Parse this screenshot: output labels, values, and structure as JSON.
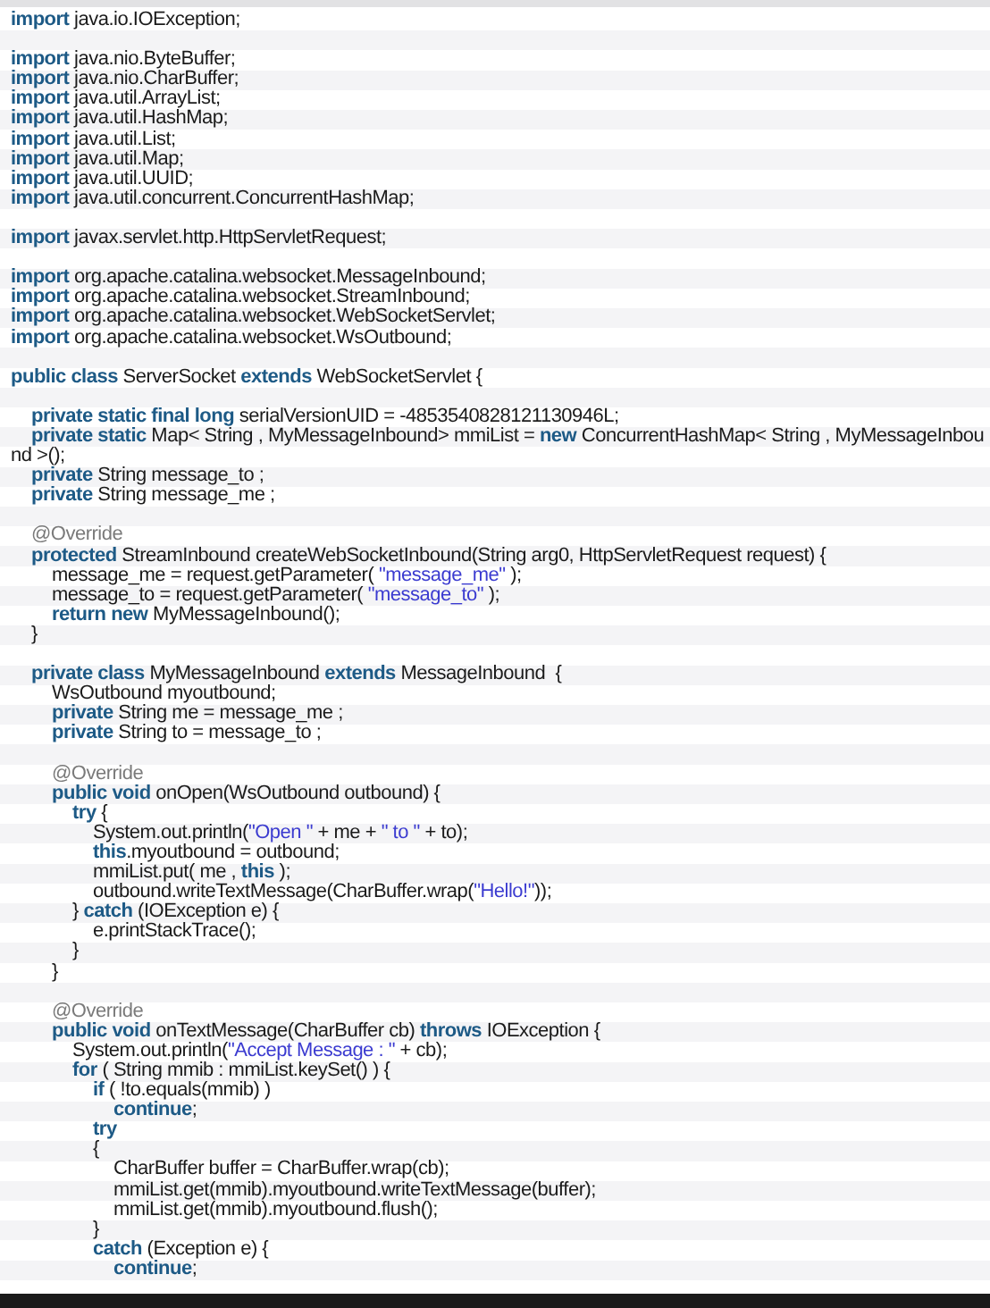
{
  "editor": {
    "lines": [
      {
        "kind": "code",
        "segments": [
          {
            "kind": "keyword",
            "text": "import"
          },
          {
            "kind": "plain",
            "text": " java.io.IOException;"
          }
        ]
      },
      {
        "kind": "blank"
      },
      {
        "kind": "code",
        "segments": [
          {
            "kind": "keyword",
            "text": "import"
          },
          {
            "kind": "plain",
            "text": " java.nio.ByteBuffer;"
          }
        ]
      },
      {
        "kind": "code",
        "segments": [
          {
            "kind": "keyword",
            "text": "import"
          },
          {
            "kind": "plain",
            "text": " java.nio.CharBuffer;"
          }
        ]
      },
      {
        "kind": "code",
        "segments": [
          {
            "kind": "keyword",
            "text": "import"
          },
          {
            "kind": "plain",
            "text": " java.util.ArrayList;"
          }
        ]
      },
      {
        "kind": "code",
        "segments": [
          {
            "kind": "keyword",
            "text": "import"
          },
          {
            "kind": "plain",
            "text": " java.util.HashMap;"
          }
        ]
      },
      {
        "kind": "code",
        "segments": [
          {
            "kind": "keyword",
            "text": "import"
          },
          {
            "kind": "plain",
            "text": " java.util.List;"
          }
        ]
      },
      {
        "kind": "code",
        "segments": [
          {
            "kind": "keyword",
            "text": "import"
          },
          {
            "kind": "plain",
            "text": " java.util.Map;"
          }
        ]
      },
      {
        "kind": "code",
        "segments": [
          {
            "kind": "keyword",
            "text": "import"
          },
          {
            "kind": "plain",
            "text": " java.util.UUID;"
          }
        ]
      },
      {
        "kind": "code",
        "segments": [
          {
            "kind": "keyword",
            "text": "import"
          },
          {
            "kind": "plain",
            "text": " java.util.concurrent.ConcurrentHashMap;"
          }
        ]
      },
      {
        "kind": "blank"
      },
      {
        "kind": "code",
        "segments": [
          {
            "kind": "keyword",
            "text": "import"
          },
          {
            "kind": "plain",
            "text": " javax.servlet.http.HttpServletRequest;"
          }
        ]
      },
      {
        "kind": "blank"
      },
      {
        "kind": "code",
        "segments": [
          {
            "kind": "keyword",
            "text": "import"
          },
          {
            "kind": "plain",
            "text": " org.apache.catalina.websocket.MessageInbound;"
          }
        ]
      },
      {
        "kind": "code",
        "segments": [
          {
            "kind": "keyword",
            "text": "import"
          },
          {
            "kind": "plain",
            "text": " org.apache.catalina.websocket.StreamInbound;"
          }
        ]
      },
      {
        "kind": "code",
        "segments": [
          {
            "kind": "keyword",
            "text": "import"
          },
          {
            "kind": "plain",
            "text": " org.apache.catalina.websocket.WebSocketServlet;"
          }
        ]
      },
      {
        "kind": "code",
        "segments": [
          {
            "kind": "keyword",
            "text": "import"
          },
          {
            "kind": "plain",
            "text": " org.apache.catalina.websocket.WsOutbound;"
          }
        ]
      },
      {
        "kind": "blank"
      },
      {
        "kind": "code",
        "segments": [
          {
            "kind": "keyword",
            "text": "public class"
          },
          {
            "kind": "plain",
            "text": " ServerSocket "
          },
          {
            "kind": "keyword",
            "text": "extends"
          },
          {
            "kind": "plain",
            "text": " WebSocketServlet {"
          }
        ]
      },
      {
        "kind": "blank"
      },
      {
        "kind": "code",
        "segments": [
          {
            "kind": "keyword",
            "text": "\tprivate static final long"
          },
          {
            "kind": "plain",
            "text": " serialVersionUID = -4853540828121130946L;"
          }
        ]
      },
      {
        "kind": "code",
        "segments": [
          {
            "kind": "keyword",
            "text": "\tprivate static"
          },
          {
            "kind": "plain",
            "text": " Map< String , MyMessageInbound> mmiList = "
          },
          {
            "kind": "keyword",
            "text": "new"
          },
          {
            "kind": "plain",
            "text": " ConcurrentHashMap< String , MyMessageInbou"
          }
        ]
      },
      {
        "kind": "code",
        "segments": [
          {
            "kind": "plain",
            "text": "nd >();"
          }
        ]
      },
      {
        "kind": "code",
        "segments": [
          {
            "kind": "keyword",
            "text": "\tprivate"
          },
          {
            "kind": "plain",
            "text": " String message_to ;"
          }
        ]
      },
      {
        "kind": "code",
        "segments": [
          {
            "kind": "keyword",
            "text": "\tprivate"
          },
          {
            "kind": "plain",
            "text": " String message_me ;"
          }
        ]
      },
      {
        "kind": "blank"
      },
      {
        "kind": "code",
        "segments": [
          {
            "kind": "annotation",
            "text": "\t@Override"
          }
        ]
      },
      {
        "kind": "code",
        "segments": [
          {
            "kind": "keyword",
            "text": "\tprotected"
          },
          {
            "kind": "plain",
            "text": " StreamInbound createWebSocketInbound(String arg0, HttpServletRequest request) {"
          }
        ]
      },
      {
        "kind": "code",
        "segments": [
          {
            "kind": "plain",
            "text": "\t\tmessage_me = request.getParameter( "
          },
          {
            "kind": "string",
            "text": "\"message_me\""
          },
          {
            "kind": "plain",
            "text": " );"
          }
        ]
      },
      {
        "kind": "code",
        "segments": [
          {
            "kind": "plain",
            "text": "\t\tmessage_to = request.getParameter( "
          },
          {
            "kind": "string",
            "text": "\"message_to\""
          },
          {
            "kind": "plain",
            "text": " );"
          }
        ]
      },
      {
        "kind": "code",
        "segments": [
          {
            "kind": "keyword",
            "text": "\t\treturn new"
          },
          {
            "kind": "plain",
            "text": " MyMessageInbound();"
          }
        ]
      },
      {
        "kind": "code",
        "segments": [
          {
            "kind": "plain",
            "text": "\t}"
          }
        ]
      },
      {
        "kind": "blank"
      },
      {
        "kind": "code",
        "segments": [
          {
            "kind": "keyword",
            "text": "\tprivate class"
          },
          {
            "kind": "plain",
            "text": " MyMessageInbound "
          },
          {
            "kind": "keyword",
            "text": "extends"
          },
          {
            "kind": "plain",
            "text": " MessageInbound  {"
          }
        ]
      },
      {
        "kind": "code",
        "segments": [
          {
            "kind": "plain",
            "text": "\t\tWsOutbound myoutbound;"
          }
        ]
      },
      {
        "kind": "code",
        "segments": [
          {
            "kind": "keyword",
            "text": "\t\tprivate"
          },
          {
            "kind": "plain",
            "text": " String me = message_me ;"
          }
        ]
      },
      {
        "kind": "code",
        "segments": [
          {
            "kind": "keyword",
            "text": "\t\tprivate"
          },
          {
            "kind": "plain",
            "text": " String to = message_to ;"
          }
        ]
      },
      {
        "kind": "blank"
      },
      {
        "kind": "code",
        "segments": [
          {
            "kind": "annotation",
            "text": "\t\t@Override"
          }
        ]
      },
      {
        "kind": "code",
        "segments": [
          {
            "kind": "keyword",
            "text": "\t\tpublic void"
          },
          {
            "kind": "plain",
            "text": " onOpen(WsOutbound outbound) {"
          }
        ]
      },
      {
        "kind": "code",
        "segments": [
          {
            "kind": "keyword",
            "text": "\t\t\ttry"
          },
          {
            "kind": "plain",
            "text": " {"
          }
        ]
      },
      {
        "kind": "code",
        "segments": [
          {
            "kind": "plain",
            "text": "\t\t\t\tSystem.out.println("
          },
          {
            "kind": "string",
            "text": "\"Open \""
          },
          {
            "kind": "plain",
            "text": " + me + "
          },
          {
            "kind": "string",
            "text": "\" to \""
          },
          {
            "kind": "plain",
            "text": " + to);"
          }
        ]
      },
      {
        "kind": "code",
        "segments": [
          {
            "kind": "keyword",
            "text": "\t\t\t\tthis"
          },
          {
            "kind": "plain",
            "text": ".myoutbound = outbound;"
          }
        ]
      },
      {
        "kind": "code",
        "segments": [
          {
            "kind": "plain",
            "text": "\t\t\t\tmmiList.put( me , "
          },
          {
            "kind": "keyword",
            "text": "this"
          },
          {
            "kind": "plain",
            "text": " );"
          }
        ]
      },
      {
        "kind": "code",
        "segments": [
          {
            "kind": "plain",
            "text": "\t\t\t\toutbound.writeTextMessage(CharBuffer.wrap("
          },
          {
            "kind": "string",
            "text": "\"Hello!\""
          },
          {
            "kind": "plain",
            "text": "));"
          }
        ]
      },
      {
        "kind": "code",
        "segments": [
          {
            "kind": "plain",
            "text": "\t\t\t} "
          },
          {
            "kind": "keyword",
            "text": "catch"
          },
          {
            "kind": "plain",
            "text": " (IOException e) {"
          }
        ]
      },
      {
        "kind": "code",
        "segments": [
          {
            "kind": "plain",
            "text": "\t\t\t\te.printStackTrace();"
          }
        ]
      },
      {
        "kind": "code",
        "segments": [
          {
            "kind": "plain",
            "text": "\t\t\t}"
          }
        ]
      },
      {
        "kind": "code",
        "segments": [
          {
            "kind": "plain",
            "text": "\t\t}"
          }
        ]
      },
      {
        "kind": "blank"
      },
      {
        "kind": "code",
        "segments": [
          {
            "kind": "annotation",
            "text": "\t\t@Override"
          }
        ]
      },
      {
        "kind": "code",
        "segments": [
          {
            "kind": "keyword",
            "text": "\t\tpublic void"
          },
          {
            "kind": "plain",
            "text": " onTextMessage(CharBuffer cb) "
          },
          {
            "kind": "keyword",
            "text": "throws"
          },
          {
            "kind": "plain",
            "text": " IOException {"
          }
        ]
      },
      {
        "kind": "code",
        "segments": [
          {
            "kind": "plain",
            "text": "\t\t\tSystem.out.println("
          },
          {
            "kind": "string",
            "text": "\"Accept Message : \""
          },
          {
            "kind": "plain",
            "text": " + cb);"
          }
        ]
      },
      {
        "kind": "code",
        "segments": [
          {
            "kind": "keyword",
            "text": "\t\t\tfor"
          },
          {
            "kind": "plain",
            "text": " ( String mmib : mmiList.keySet() ) {"
          }
        ]
      },
      {
        "kind": "code",
        "segments": [
          {
            "kind": "keyword",
            "text": "\t\t\t\tif"
          },
          {
            "kind": "plain",
            "text": " ( !to.equals(mmib) )"
          }
        ]
      },
      {
        "kind": "code",
        "segments": [
          {
            "kind": "keyword",
            "text": "\t\t\t\t\tcontinue"
          },
          {
            "kind": "plain",
            "text": ";"
          }
        ]
      },
      {
        "kind": "code",
        "segments": [
          {
            "kind": "keyword",
            "text": "\t\t\t\ttry"
          }
        ]
      },
      {
        "kind": "code",
        "segments": [
          {
            "kind": "plain",
            "text": "\t\t\t\t{"
          }
        ]
      },
      {
        "kind": "code",
        "segments": [
          {
            "kind": "plain",
            "text": "\t\t\t\t\tCharBuffer buffer = CharBuffer.wrap(cb);"
          }
        ]
      },
      {
        "kind": "code",
        "segments": [
          {
            "kind": "plain",
            "text": "\t\t\t\t\tmmiList.get(mmib).myoutbound.writeTextMessage(buffer);"
          }
        ]
      },
      {
        "kind": "code",
        "segments": [
          {
            "kind": "plain",
            "text": "\t\t\t\t\tmmiList.get(mmib).myoutbound.flush();"
          }
        ]
      },
      {
        "kind": "code",
        "segments": [
          {
            "kind": "plain",
            "text": "\t\t\t\t}"
          }
        ]
      },
      {
        "kind": "code",
        "segments": [
          {
            "kind": "keyword",
            "text": "\t\t\t\tcatch"
          },
          {
            "kind": "plain",
            "text": " (Exception e) {"
          }
        ]
      },
      {
        "kind": "code",
        "segments": [
          {
            "kind": "keyword",
            "text": "\t\t\t\t\tcontinue"
          },
          {
            "kind": "plain",
            "text": ";"
          }
        ]
      }
    ]
  }
}
